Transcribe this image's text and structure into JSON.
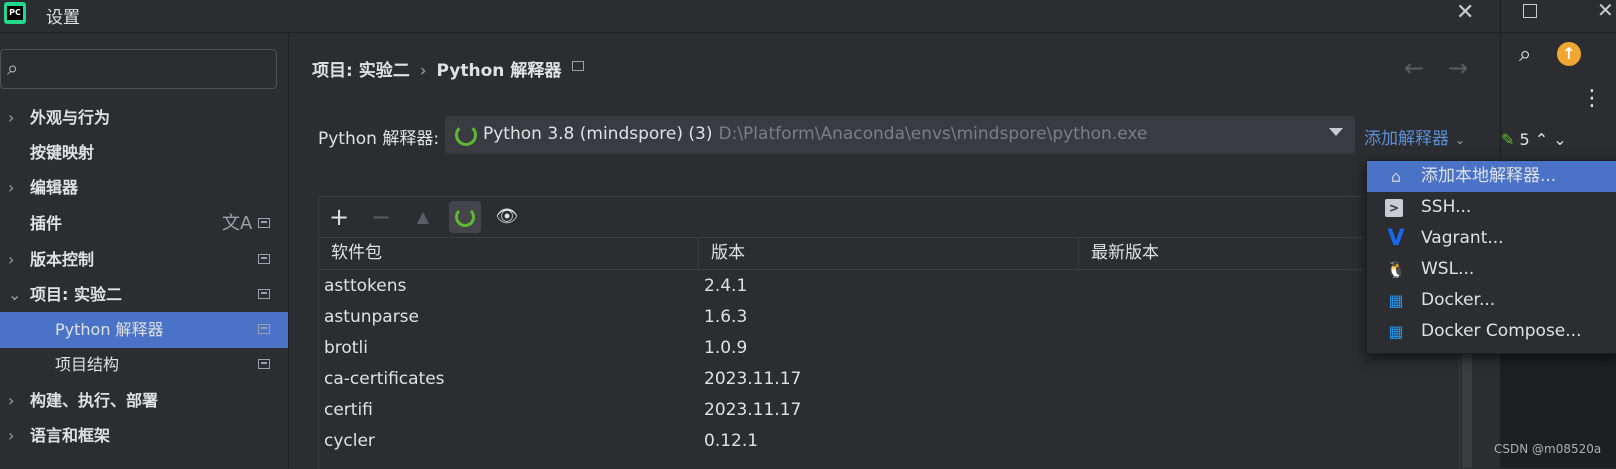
{
  "window": {
    "title": "设置",
    "app_icon_text": "PC"
  },
  "search": {
    "placeholder": ""
  },
  "sidebar": {
    "items": [
      {
        "label": "外观与行为",
        "expandable": true
      },
      {
        "label": "按键映射",
        "expandable": false
      },
      {
        "label": "编辑器",
        "expandable": true
      },
      {
        "label": "插件",
        "expandable": false
      },
      {
        "label": "版本控制",
        "expandable": true
      },
      {
        "label": "项目: 实验二",
        "expandable": true,
        "expanded": true
      },
      {
        "label": "Python 解释器",
        "sub": true,
        "selected": true
      },
      {
        "label": "项目结构",
        "sub": true
      },
      {
        "label": "构建、执行、部署",
        "expandable": true
      },
      {
        "label": "语言和框架",
        "expandable": true
      }
    ]
  },
  "breadcrumb": {
    "project": "项目: 实验二",
    "page": "Python 解释器"
  },
  "interpreter": {
    "label": "Python 解释器:",
    "name": "Python 3.8 (mindspore) (3)",
    "path": "D:\\Platform\\Anaconda\\envs\\mindspore\\python.exe",
    "add_label": "添加解释器"
  },
  "table": {
    "headers": [
      "软件包",
      "版本",
      "最新版本"
    ],
    "rows": [
      {
        "name": "asttokens",
        "version": "2.4.1"
      },
      {
        "name": "astunparse",
        "version": "1.6.3"
      },
      {
        "name": "brotli",
        "version": "1.0.9"
      },
      {
        "name": "ca-certificates",
        "version": "2023.11.17"
      },
      {
        "name": "certifi",
        "version": "2023.11.17"
      },
      {
        "name": "cycler",
        "version": "0.12.1"
      }
    ]
  },
  "menu": {
    "items": [
      {
        "label": "添加本地解释器...",
        "icon": "home-icon",
        "selected": true
      },
      {
        "label": "SSH...",
        "icon": "terminal-icon"
      },
      {
        "label": "Vagrant...",
        "icon": "vagrant-icon"
      },
      {
        "label": "WSL...",
        "icon": "linux-icon"
      },
      {
        "label": "Docker...",
        "icon": "docker-icon"
      },
      {
        "label": "Docker Compose...",
        "icon": "docker-icon"
      }
    ]
  },
  "right_strip": {
    "count": "5"
  },
  "watermark": "CSDN @m08520a",
  "colors": {
    "accent": "#4a72c7",
    "link": "#5a8fd8",
    "spinner": "#5fb832"
  }
}
